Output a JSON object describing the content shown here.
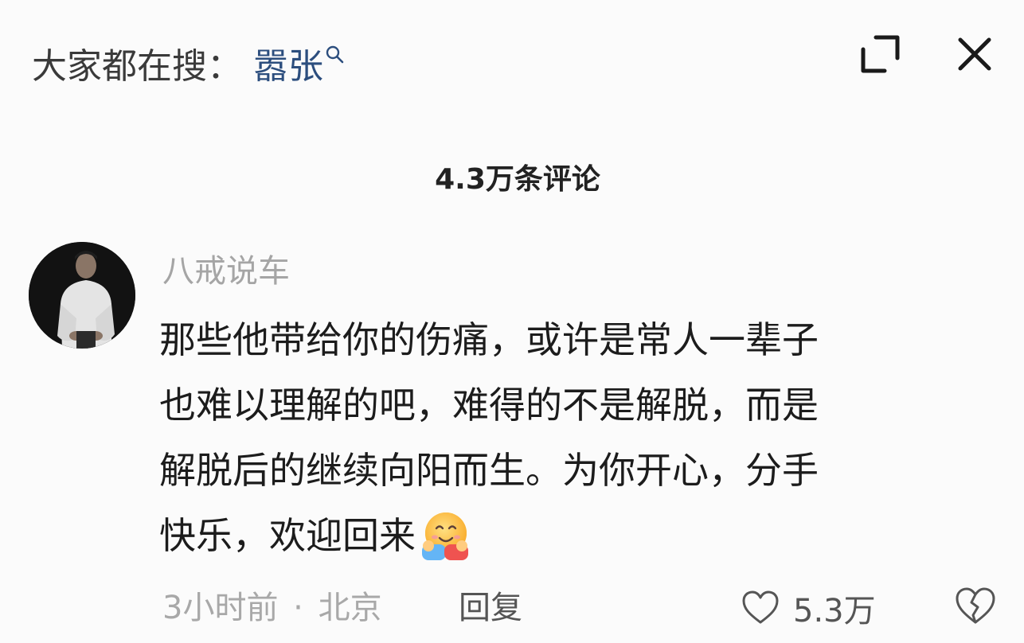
{
  "header": {
    "search_prefix": "大家都在搜：",
    "search_keyword": "嚣张",
    "icons": {
      "search": "search-icon",
      "expand": "expand-icon",
      "close": "close-icon"
    }
  },
  "comments_header": {
    "count_label": "4.3万条评论"
  },
  "comment": {
    "avatar": "avatar",
    "username": "八戒说车",
    "text_lines": [
      "那些他带给你的伤痛，或许是常人一辈子",
      "也难以理解的吧，难得的不是解脱，而是",
      "解脱后的继续向阳而生。为你开心，分手",
      "快乐，欢迎回来"
    ],
    "emoji": "hugging-face-emoji",
    "time": "3小时前",
    "separator": "·",
    "location": "北京",
    "reply_label": "回复",
    "like_count": "5.3万",
    "icons": {
      "like": "heart-outline-icon",
      "dislike": "broken-heart-icon"
    }
  },
  "colors": {
    "background": "#fbfbfb",
    "keyword": "#2c4e7e",
    "primary_text": "#1c1c1c",
    "secondary_text": "#a8a8a8"
  }
}
